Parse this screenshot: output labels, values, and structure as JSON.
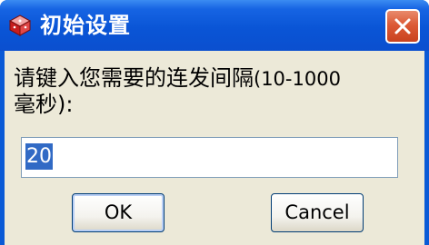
{
  "window": {
    "title": "初始设置",
    "icon": "app-cube-icon",
    "close_icon": "close-x-icon"
  },
  "dialog": {
    "prompt_main": "请键入您需要的连发间隔",
    "prompt_range": "(10-1000",
    "prompt_line2": "毫秒):",
    "input_value": "20",
    "ok_label": "OK",
    "cancel_label": "Cancel"
  },
  "colors": {
    "titlebar": "#0a55d6",
    "client_bg": "#ece9d8",
    "close_button": "#dc5a36",
    "selection": "#316ac5"
  }
}
